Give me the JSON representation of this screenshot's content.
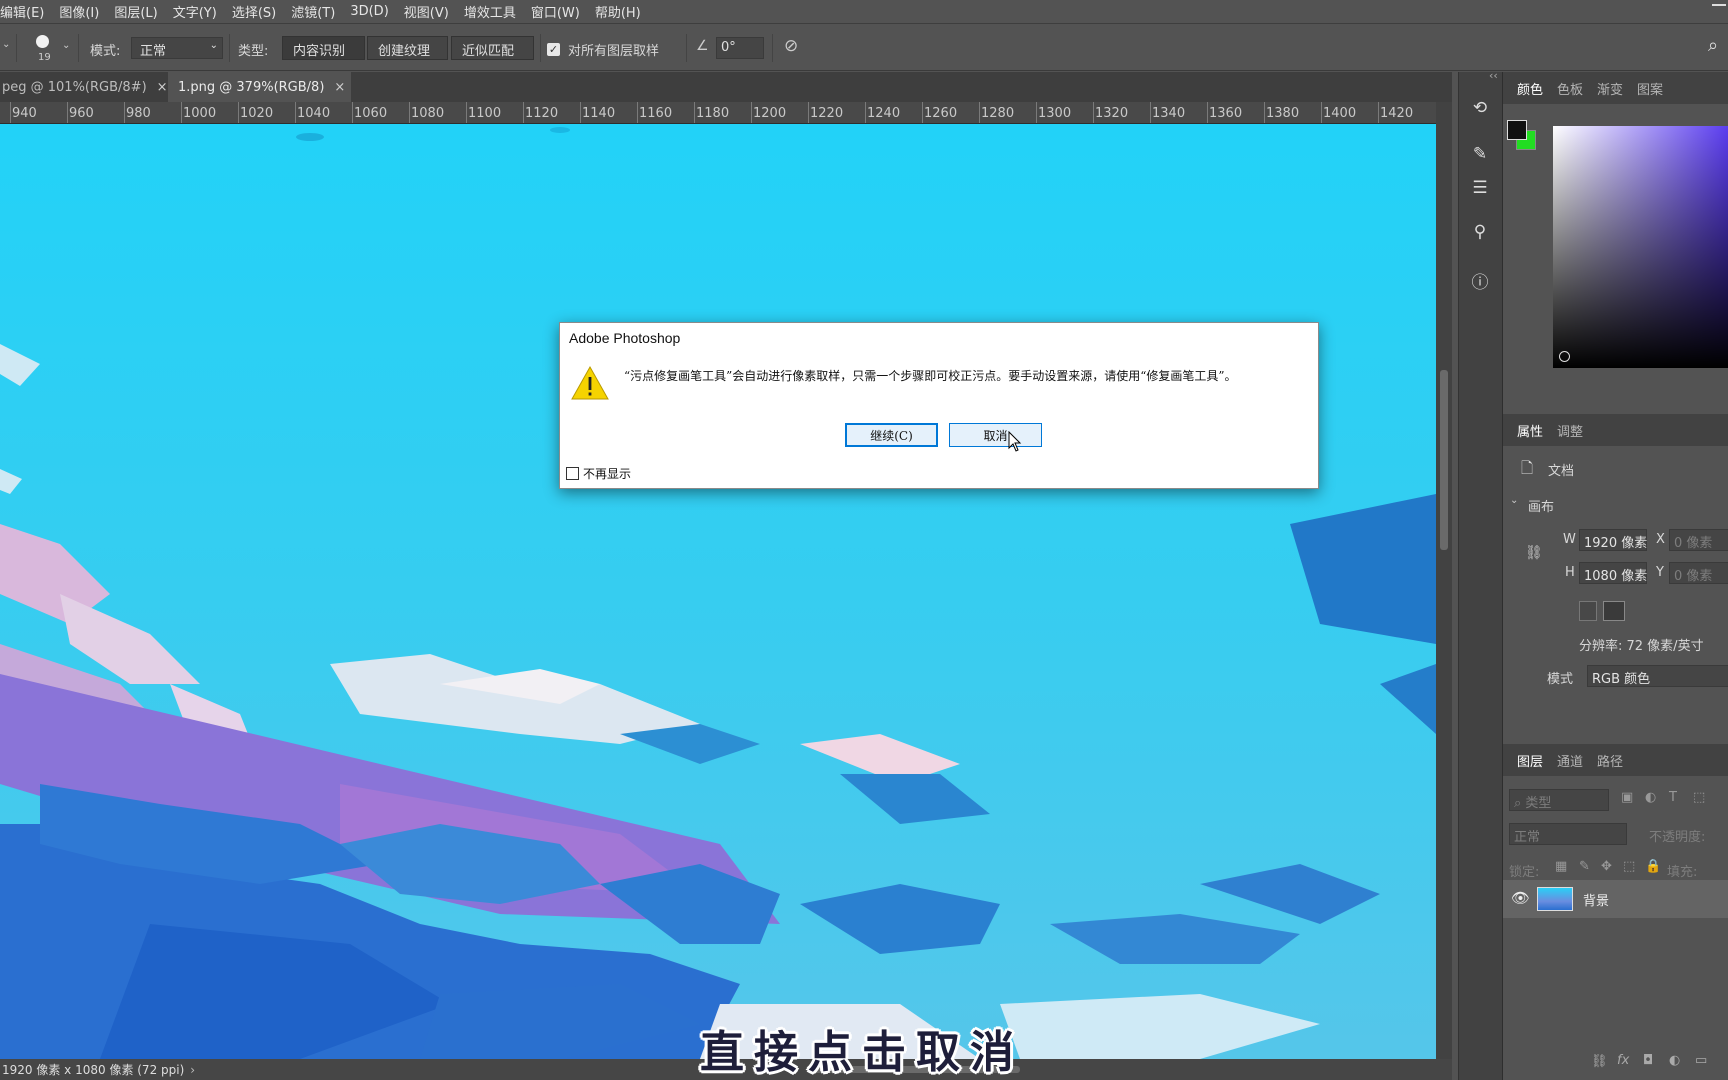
{
  "menu": [
    "编辑(E)",
    "图像(I)",
    "图层(L)",
    "文字(Y)",
    "选择(S)",
    "滤镜(T)",
    "3D(D)",
    "视图(V)",
    "增效工具",
    "窗口(W)",
    "帮助(H)"
  ],
  "options": {
    "brush_size": "19",
    "mode_label": "模式:",
    "mode_value": "正常",
    "type_label": "类型:",
    "type_buttons": [
      "内容识别",
      "创建纹理",
      "近似匹配"
    ],
    "sample_all_label": "对所有图层取样",
    "angle_value": "0°"
  },
  "tabs": [
    {
      "label": "peg @ 101%(RGB/8#)",
      "close": "×"
    },
    {
      "label": "1.png @ 379%(RGB/8)",
      "close": "×"
    }
  ],
  "ruler_ticks": [
    "940",
    "960",
    "980",
    "1000",
    "1020",
    "1040",
    "1060",
    "1080",
    "1100",
    "1120",
    "1140",
    "1160",
    "1180",
    "1200",
    "1220",
    "1240",
    "1260",
    "1280",
    "1300",
    "1320",
    "1340",
    "1360",
    "1380",
    "1400",
    "1420"
  ],
  "status_text": "1920 像素 x 1080 像素 (72 ppi)",
  "dialog": {
    "title": "Adobe Photoshop",
    "message": "“污点修复画笔工具”会自动进行像素取样，只需一个步骤即可校正污点。要手动设置来源，请使用“修复画笔工具”。",
    "continue_label": "继续(C)",
    "cancel_label": "取消",
    "dont_show_label": "不再显示"
  },
  "caption": "直接点击取消",
  "color_panel": {
    "tabs": [
      "颜色",
      "色板",
      "渐变",
      "图案"
    ],
    "foreground": "#111111",
    "background": "#22dd22"
  },
  "properties_panel": {
    "tabs": [
      "属性",
      "调整"
    ],
    "doc_label": "文档",
    "section": "画布",
    "w_label": "W",
    "w_value": "1920 像素",
    "h_label": "H",
    "h_value": "1080 像素",
    "x_label": "X",
    "x_value": "0 像素",
    "y_label": "Y",
    "y_value": "0 像素",
    "resolution": "分辨率: 72 像素/英寸",
    "mode_label": "模式",
    "mode_value": "RGB 颜色"
  },
  "layers_panel": {
    "tabs": [
      "图层",
      "通道",
      "路径"
    ],
    "search_placeholder": "类型",
    "blend_mode": "正常",
    "opacity_label": "不透明度:",
    "lock_label": "锁定:",
    "fill_label": "填充:",
    "layer_name": "背景",
    "footer_icons": [
      "link-icon",
      "fx-icon",
      "mask-icon",
      "adjustment-icon",
      "folder-icon"
    ]
  }
}
